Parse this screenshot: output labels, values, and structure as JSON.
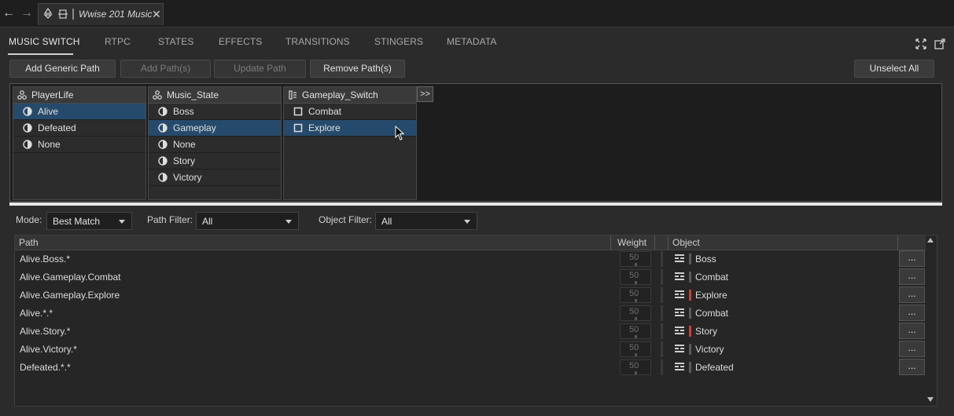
{
  "window": {
    "back_icon": "arrow-left-icon",
    "forward_icon": "arrow-right-icon",
    "tab_title": "Wwise 201 Music",
    "close_glyph": "✕"
  },
  "tabs": [
    "MUSIC SWITCH",
    "RTPC",
    "STATES",
    "EFFECTS",
    "TRANSITIONS",
    "STINGERS",
    "METADATA"
  ],
  "toolbar": {
    "add_generic_path": "Add Generic Path",
    "add_paths": "Add Path(s)",
    "update_path": "Update Path",
    "remove_paths": "Remove Path(s)",
    "unselect_all": "Unselect All"
  },
  "switch_columns": [
    {
      "header": "PlayerLife",
      "items": [
        "Alive",
        "Defeated",
        "None"
      ],
      "selected": "Alive"
    },
    {
      "header": "Music_State",
      "items": [
        "Boss",
        "Gameplay",
        "None",
        "Story",
        "Victory"
      ],
      "selected": "Gameplay"
    },
    {
      "header": "Gameplay_Switch",
      "items": [
        "Combat",
        "Explore"
      ],
      "selected": "Explore"
    }
  ],
  "more_label": ">>",
  "filters": {
    "mode_label": "Mode:",
    "mode_value": "Best Match",
    "path_filter_label": "Path Filter:",
    "path_filter_value": "All",
    "object_filter_label": "Object Filter:",
    "object_filter_value": "All"
  },
  "table": {
    "headers": {
      "path": "Path",
      "weight": "Weight",
      "object": "Object"
    },
    "rows": [
      {
        "path": "Alive.Boss.*",
        "weight": "50",
        "object": "Boss",
        "marker": "gray"
      },
      {
        "path": "Alive.Gameplay.Combat",
        "weight": "50",
        "object": "Combat",
        "marker": "gray"
      },
      {
        "path": "Alive.Gameplay.Explore",
        "weight": "50",
        "object": "Explore",
        "marker": "red"
      },
      {
        "path": "Alive.*.*",
        "weight": "50",
        "object": "Combat",
        "marker": "gray"
      },
      {
        "path": "Alive.Story.*",
        "weight": "50",
        "object": "Story",
        "marker": "red"
      },
      {
        "path": "Alive.Victory.*",
        "weight": "50",
        "object": "Victory",
        "marker": "gray"
      },
      {
        "path": "Defeated.*.*",
        "weight": "50",
        "object": "Defeated",
        "marker": "gray"
      }
    ],
    "dots_label": "..."
  },
  "colors": {
    "selected_row": "#264a6b",
    "marker_red": "#c8423a"
  }
}
